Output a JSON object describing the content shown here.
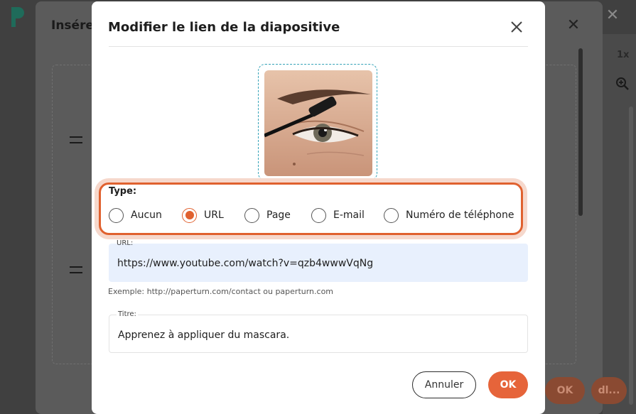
{
  "background": {
    "zoom_label": "1x",
    "under_dialog_title": "Insére",
    "under_ok_label": "OK",
    "under_ok2_label": "dl..."
  },
  "dialog": {
    "title": "Modifier le lien de la diapositive",
    "type_label": "Type:",
    "radio_options": [
      {
        "label": "Aucun",
        "checked": false
      },
      {
        "label": "URL",
        "checked": true
      },
      {
        "label": "Page",
        "checked": false
      },
      {
        "label": "E-mail",
        "checked": false
      },
      {
        "label": "Numéro de téléphone",
        "checked": false
      }
    ],
    "url_field": {
      "label": "URL:",
      "value": "https://www.youtube.com/watch?v=qzb4wwwVqNg"
    },
    "hint": "Exemple: http://paperturn.com/contact ou paperturn.com",
    "title_field": {
      "label": "Titre:",
      "value": "Apprenez à appliquer du mascara."
    },
    "cancel_label": "Annuler",
    "ok_label": "OK"
  },
  "colors": {
    "accent": "#e6643a",
    "highlight_ring": "#e0612f",
    "url_field_bg": "#e8f0fd",
    "thumb_border": "#35a3b8"
  },
  "icons": {
    "close": "close-icon",
    "zoom": "zoom-in-icon",
    "logo": "paperturn-logo-icon"
  }
}
